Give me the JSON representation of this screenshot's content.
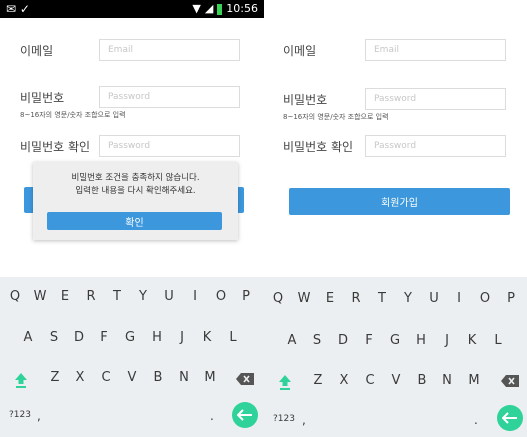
{
  "status_bar": {
    "time": "10:56",
    "icons": [
      "mail-icon",
      "check-icon",
      "wifi-icon",
      "signal-icon",
      "battery-icon"
    ]
  },
  "form": {
    "email_label": "이메일",
    "email_placeholder": "Email",
    "password_label": "비밀번호",
    "password_placeholder": "Password",
    "password_hint": "8~16자의 영문/숫자 조합으로 입력",
    "confirm_label": "비밀번호 확인",
    "confirm_placeholder": "Password",
    "signup_button": "회원가입"
  },
  "dialog": {
    "line1": "비밀번호 조건을 충족하지 않습니다.",
    "line2": "입력한 내용을 다시 확인해주세요.",
    "ok_button": "확인"
  },
  "keyboard": {
    "row1": [
      "Q",
      "W",
      "E",
      "R",
      "T",
      "Y",
      "U",
      "I",
      "O",
      "P"
    ],
    "row2": [
      "A",
      "S",
      "D",
      "F",
      "G",
      "H",
      "J",
      "K",
      "L"
    ],
    "row3": [
      "Z",
      "X",
      "C",
      "V",
      "B",
      "N",
      "M"
    ],
    "symbols_key": "?123",
    "comma_key": ",",
    "period_key": ".",
    "colors": {
      "accent": "#2fd39a",
      "shift": "#2fd39a",
      "background": "#eceff1"
    }
  },
  "colors": {
    "primary": "#3c97dc",
    "field_border": "#dcdcdc"
  }
}
